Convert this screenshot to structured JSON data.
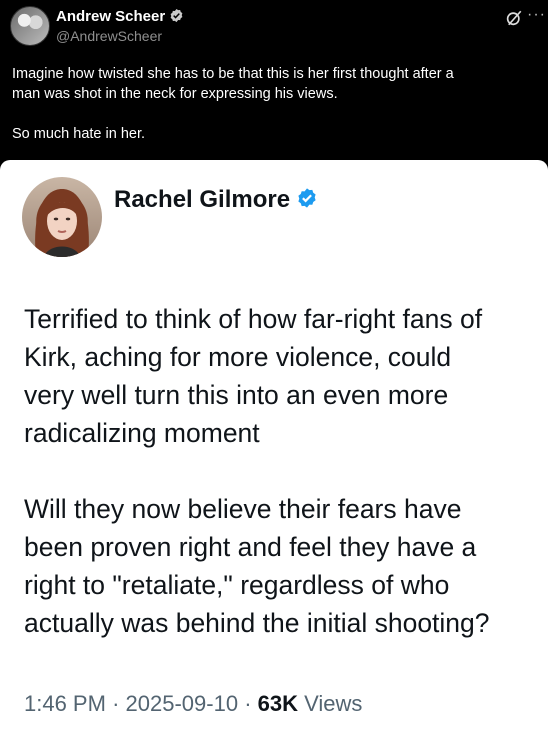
{
  "post": {
    "author_name": "Andrew Scheer",
    "author_handle": "@AndrewScheer",
    "text": "Imagine how twisted she has to be that this is her first thought after a\nman was shot in the neck for expressing his views.\n\nSo much hate in her.",
    "icons": {
      "verified": "verified-badge-icon",
      "grok": "grok-icon",
      "more": "more-options-icon"
    },
    "more_glyph": "···"
  },
  "quoted": {
    "author_name": "Rachel Gilmore",
    "body": "Terrified to think of how far-right fans of\nKirk, aching for more violence, could\nvery well turn this into an even more\nradicalizing moment\n\nWill they now believe their fears have\nbeen proven right and feel they have a\nright to \"retaliate,\" regardless of who\nactually was behind the initial shooting?",
    "time": "1:46 PM",
    "date": "2025-09-10",
    "separator": "·",
    "views_count": "63K",
    "views_label": "Views"
  },
  "colors": {
    "background": "#000000",
    "card_background": "#ffffff",
    "verified_blue": "#1d9bf0",
    "secondary_text": "#536471"
  }
}
